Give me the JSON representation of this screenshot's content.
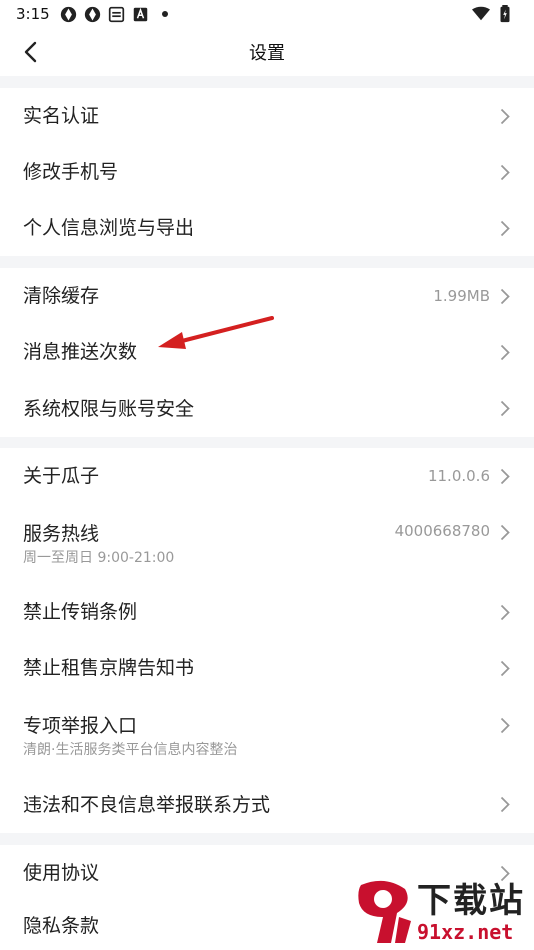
{
  "status_bar": {
    "time": "3:15",
    "left_icons": [
      "aperture-icon",
      "aperture-icon",
      "notebook-icon",
      "a-box-icon",
      "dot-icon"
    ],
    "right_icons": [
      "wifi-icon",
      "battery-icon"
    ]
  },
  "nav": {
    "title": "设置",
    "back_icon": "chevron-left-icon"
  },
  "groups": [
    {
      "items": [
        {
          "label": "实名认证"
        },
        {
          "label": "修改手机号"
        },
        {
          "label": "个人信息浏览与导出"
        }
      ]
    },
    {
      "items": [
        {
          "label": "清除缓存",
          "value": "1.99MB"
        },
        {
          "label": "消息推送次数"
        },
        {
          "label": "系统权限与账号安全"
        }
      ]
    },
    {
      "items": [
        {
          "label": "关于瓜子",
          "value": "11.0.0.6"
        },
        {
          "label": "服务热线",
          "sublabel": "周一至周日 9:00-21:00",
          "value": "4000668780"
        },
        {
          "label": "禁止传销条例"
        },
        {
          "label": "禁止租售京牌告知书"
        },
        {
          "label": "专项举报入口",
          "sublabel": "清朗·生活服务类平台信息内容整治"
        },
        {
          "label": "违法和不良信息举报联系方式"
        }
      ]
    },
    {
      "items": [
        {
          "label": "使用协议"
        },
        {
          "label": "隐私条款"
        }
      ]
    }
  ],
  "annotation": {
    "type": "red-arrow",
    "color": "#d42020"
  },
  "watermark": {
    "big_text": "下载站",
    "small_text": "91xz.net",
    "logo_color": "#c8102e"
  },
  "colors": {
    "divider_gap": "#f4f5f7",
    "chevron": "#999999",
    "secondary_text": "#999999"
  }
}
